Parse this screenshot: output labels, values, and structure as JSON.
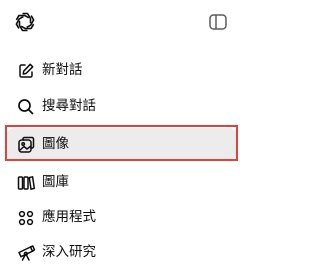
{
  "sidebar": {
    "logo_icon": "openai-logo-icon",
    "toggle_icon": "sidebar-toggle-icon",
    "items": [
      {
        "label": "新對話",
        "icon": "edit-icon"
      },
      {
        "label": "搜尋對話",
        "icon": "search-icon"
      },
      {
        "label": "圖像",
        "icon": "image-icon",
        "active": true
      },
      {
        "label": "圖庫",
        "icon": "library-icon"
      },
      {
        "label": "應用程式",
        "icon": "apps-grid-icon"
      },
      {
        "label": "深入研究",
        "icon": "telescope-icon"
      }
    ]
  },
  "colors": {
    "highlight_border": "#e0433a",
    "active_background": "#ececec",
    "text": "#0d0d0d"
  }
}
